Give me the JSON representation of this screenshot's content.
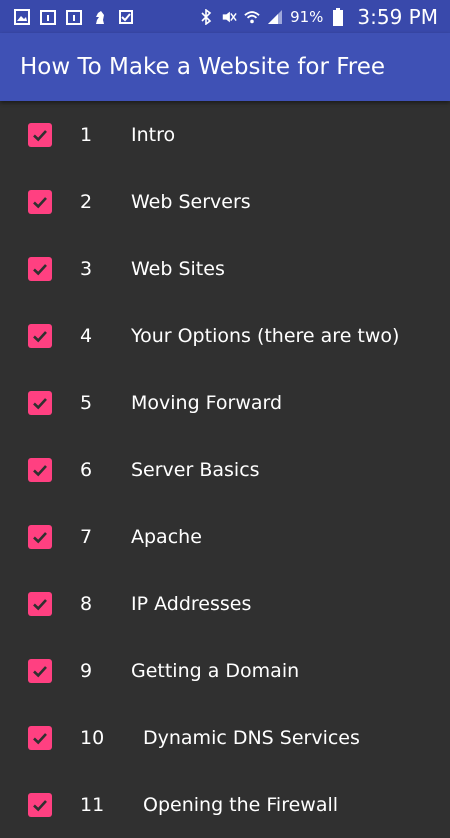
{
  "status_bar": {
    "battery_percent": "91%",
    "time": "3:59 PM"
  },
  "app_bar": {
    "title": "How To Make a Website for Free"
  },
  "items": [
    {
      "number": "1",
      "label": "Intro",
      "checked": true
    },
    {
      "number": "2",
      "label": "Web Servers",
      "checked": true
    },
    {
      "number": "3",
      "label": "Web Sites",
      "checked": true
    },
    {
      "number": "4",
      "label": "Your Options (there are two)",
      "checked": true
    },
    {
      "number": "5",
      "label": "Moving Forward",
      "checked": true
    },
    {
      "number": "6",
      "label": "Server Basics",
      "checked": true
    },
    {
      "number": "7",
      "label": "Apache",
      "checked": true
    },
    {
      "number": "8",
      "label": "IP Addresses",
      "checked": true
    },
    {
      "number": "9",
      "label": "Getting a Domain",
      "checked": true
    },
    {
      "number": "10",
      "label": "Dynamic DNS Services",
      "checked": true
    },
    {
      "number": "11",
      "label": "Opening the Firewall",
      "checked": true
    }
  ],
  "colors": {
    "status_bar": "#3949AB",
    "app_bar": "#3F51B5",
    "background": "#303030",
    "checkbox": "#FF4081"
  }
}
